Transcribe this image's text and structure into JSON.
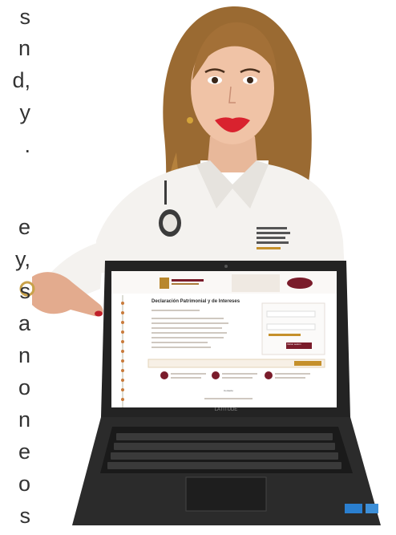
{
  "left_fragments": [
    {
      "text": "s"
    },
    {
      "text": "n"
    },
    {
      "text": "d,"
    },
    {
      "text": "y"
    },
    {
      "text": "."
    },
    {
      "text": "e"
    },
    {
      "text": "y,"
    },
    {
      "text": "s"
    },
    {
      "text": "a"
    },
    {
      "text": "n"
    },
    {
      "text": "o"
    },
    {
      "text": "n"
    },
    {
      "text": "e"
    },
    {
      "text": "o"
    },
    {
      "text": "s"
    }
  ],
  "screen": {
    "title": "Declaración Patrimonial y de Intereses",
    "login_button": "Iniciar sesión",
    "footer_link": "Contacto"
  },
  "colors": {
    "accent": "#7a1c2b",
    "shirt": "#f4f2ef",
    "laptop": "#232323"
  }
}
